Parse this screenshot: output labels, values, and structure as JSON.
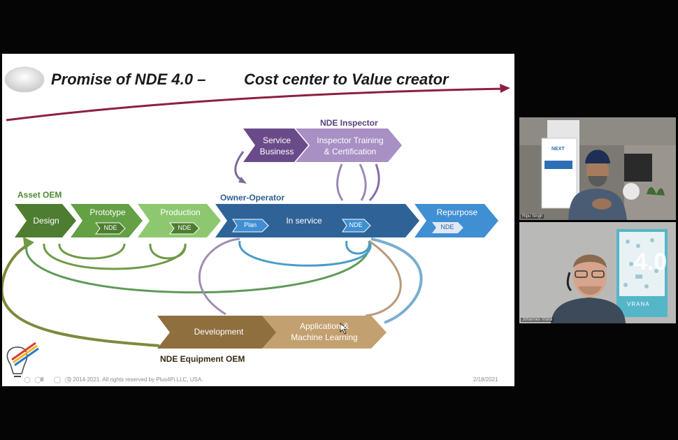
{
  "slide": {
    "title_left": "Promise of NDE 4.0 –",
    "title_right": "Cost center to Value creator",
    "groups": {
      "nde_inspector": "NDE Inspector",
      "asset_oem": "Asset OEM",
      "owner_operator": "Owner-Operator",
      "nde_equipment_oem": "NDE Equipment OEM"
    },
    "stages": {
      "design": "Design",
      "prototype": "Prototype",
      "production": "Production",
      "in_service": "In service",
      "repurpose": "Repurpose",
      "service_business_1": "Service",
      "service_business_2": "Business",
      "inspector_training_1": "Inspector Training",
      "inspector_training_2": "& Certification",
      "development": "Development",
      "application_ml_1": "Application &",
      "application_ml_2": "Machine Learning"
    },
    "tags": {
      "nde": "NDE",
      "plan": "Plan"
    },
    "footer": {
      "page_number": "8",
      "copyright": "© 2014-2021. All rights reserved by Plus4Pi LLC, USA.",
      "date": "2/18/2021"
    }
  },
  "participants": [
    {
      "name": "Ripu Singh",
      "banner_text": "NEXT"
    },
    {
      "name": "Johannes Vrana",
      "book_text": "4.0",
      "book_label": "VRANA"
    }
  ],
  "colors": {
    "dark_green": "#4e7d31",
    "mid_green": "#64a044",
    "light_green": "#8dc870",
    "dark_blue": "#2f6397",
    "light_blue": "#3f8fd2",
    "purple": "#6a4b8a",
    "lavender": "#a88fc4",
    "brown": "#8f6f3e",
    "tan": "#c3a06f",
    "title_arrow": "#8c2040"
  }
}
